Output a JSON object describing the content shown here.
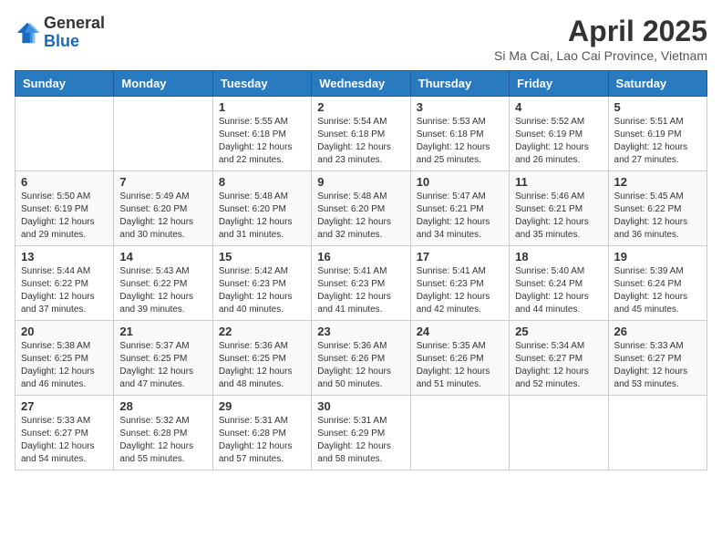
{
  "logo": {
    "general": "General",
    "blue": "Blue"
  },
  "header": {
    "month": "April 2025",
    "location": "Si Ma Cai, Lao Cai Province, Vietnam"
  },
  "days_of_week": [
    "Sunday",
    "Monday",
    "Tuesday",
    "Wednesday",
    "Thursday",
    "Friday",
    "Saturday"
  ],
  "weeks": [
    [
      {
        "day": "",
        "info": ""
      },
      {
        "day": "",
        "info": ""
      },
      {
        "day": "1",
        "info": "Sunrise: 5:55 AM\nSunset: 6:18 PM\nDaylight: 12 hours and 22 minutes."
      },
      {
        "day": "2",
        "info": "Sunrise: 5:54 AM\nSunset: 6:18 PM\nDaylight: 12 hours and 23 minutes."
      },
      {
        "day": "3",
        "info": "Sunrise: 5:53 AM\nSunset: 6:18 PM\nDaylight: 12 hours and 25 minutes."
      },
      {
        "day": "4",
        "info": "Sunrise: 5:52 AM\nSunset: 6:19 PM\nDaylight: 12 hours and 26 minutes."
      },
      {
        "day": "5",
        "info": "Sunrise: 5:51 AM\nSunset: 6:19 PM\nDaylight: 12 hours and 27 minutes."
      }
    ],
    [
      {
        "day": "6",
        "info": "Sunrise: 5:50 AM\nSunset: 6:19 PM\nDaylight: 12 hours and 29 minutes."
      },
      {
        "day": "7",
        "info": "Sunrise: 5:49 AM\nSunset: 6:20 PM\nDaylight: 12 hours and 30 minutes."
      },
      {
        "day": "8",
        "info": "Sunrise: 5:48 AM\nSunset: 6:20 PM\nDaylight: 12 hours and 31 minutes."
      },
      {
        "day": "9",
        "info": "Sunrise: 5:48 AM\nSunset: 6:20 PM\nDaylight: 12 hours and 32 minutes."
      },
      {
        "day": "10",
        "info": "Sunrise: 5:47 AM\nSunset: 6:21 PM\nDaylight: 12 hours and 34 minutes."
      },
      {
        "day": "11",
        "info": "Sunrise: 5:46 AM\nSunset: 6:21 PM\nDaylight: 12 hours and 35 minutes."
      },
      {
        "day": "12",
        "info": "Sunrise: 5:45 AM\nSunset: 6:22 PM\nDaylight: 12 hours and 36 minutes."
      }
    ],
    [
      {
        "day": "13",
        "info": "Sunrise: 5:44 AM\nSunset: 6:22 PM\nDaylight: 12 hours and 37 minutes."
      },
      {
        "day": "14",
        "info": "Sunrise: 5:43 AM\nSunset: 6:22 PM\nDaylight: 12 hours and 39 minutes."
      },
      {
        "day": "15",
        "info": "Sunrise: 5:42 AM\nSunset: 6:23 PM\nDaylight: 12 hours and 40 minutes."
      },
      {
        "day": "16",
        "info": "Sunrise: 5:41 AM\nSunset: 6:23 PM\nDaylight: 12 hours and 41 minutes."
      },
      {
        "day": "17",
        "info": "Sunrise: 5:41 AM\nSunset: 6:23 PM\nDaylight: 12 hours and 42 minutes."
      },
      {
        "day": "18",
        "info": "Sunrise: 5:40 AM\nSunset: 6:24 PM\nDaylight: 12 hours and 44 minutes."
      },
      {
        "day": "19",
        "info": "Sunrise: 5:39 AM\nSunset: 6:24 PM\nDaylight: 12 hours and 45 minutes."
      }
    ],
    [
      {
        "day": "20",
        "info": "Sunrise: 5:38 AM\nSunset: 6:25 PM\nDaylight: 12 hours and 46 minutes."
      },
      {
        "day": "21",
        "info": "Sunrise: 5:37 AM\nSunset: 6:25 PM\nDaylight: 12 hours and 47 minutes."
      },
      {
        "day": "22",
        "info": "Sunrise: 5:36 AM\nSunset: 6:25 PM\nDaylight: 12 hours and 48 minutes."
      },
      {
        "day": "23",
        "info": "Sunrise: 5:36 AM\nSunset: 6:26 PM\nDaylight: 12 hours and 50 minutes."
      },
      {
        "day": "24",
        "info": "Sunrise: 5:35 AM\nSunset: 6:26 PM\nDaylight: 12 hours and 51 minutes."
      },
      {
        "day": "25",
        "info": "Sunrise: 5:34 AM\nSunset: 6:27 PM\nDaylight: 12 hours and 52 minutes."
      },
      {
        "day": "26",
        "info": "Sunrise: 5:33 AM\nSunset: 6:27 PM\nDaylight: 12 hours and 53 minutes."
      }
    ],
    [
      {
        "day": "27",
        "info": "Sunrise: 5:33 AM\nSunset: 6:27 PM\nDaylight: 12 hours and 54 minutes."
      },
      {
        "day": "28",
        "info": "Sunrise: 5:32 AM\nSunset: 6:28 PM\nDaylight: 12 hours and 55 minutes."
      },
      {
        "day": "29",
        "info": "Sunrise: 5:31 AM\nSunset: 6:28 PM\nDaylight: 12 hours and 57 minutes."
      },
      {
        "day": "30",
        "info": "Sunrise: 5:31 AM\nSunset: 6:29 PM\nDaylight: 12 hours and 58 minutes."
      },
      {
        "day": "",
        "info": ""
      },
      {
        "day": "",
        "info": ""
      },
      {
        "day": "",
        "info": ""
      }
    ]
  ]
}
